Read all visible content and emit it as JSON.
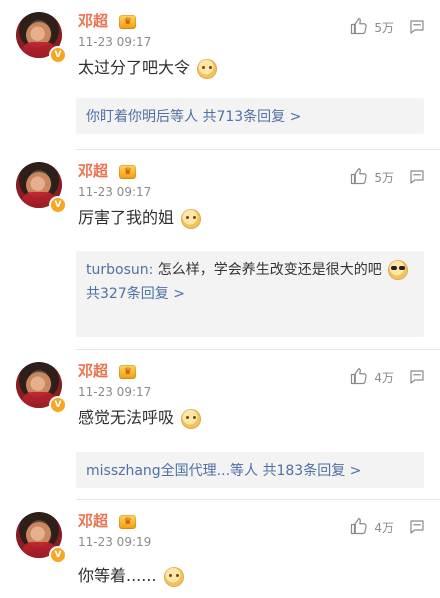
{
  "comments": [
    {
      "user": "邓超",
      "time": "11-23 09:17",
      "likes": "5万",
      "text": "太过分了吧大令",
      "reply_summary": {
        "users": "你盯着你明后",
        "suffix": "等人",
        "count": "共713条回复",
        "chevron": ">"
      }
    },
    {
      "user": "邓超",
      "time": "11-23 09:17",
      "likes": "5万",
      "text": "厉害了我的姐",
      "reply_preview": {
        "user": "turbosun:",
        "text": "怎么样，学会养生改变还是很大的吧",
        "count": "共327条回复",
        "chevron": ">"
      }
    },
    {
      "user": "邓超",
      "time": "11-23 09:17",
      "likes": "4万",
      "text": "感觉无法呼吸",
      "reply_summary": {
        "users": "misszhang全国代理...",
        "suffix": "等人",
        "count": "共183条回复",
        "chevron": ">"
      }
    },
    {
      "user": "邓超",
      "time": "11-23 09:19",
      "likes": "4万",
      "text": "你等着......"
    }
  ],
  "badges": {
    "vip_label": "V",
    "crown_label": "♛"
  },
  "icons": {
    "like": "thumbs-up-icon",
    "reply": "comment-icon",
    "emoji": "doge-emoji",
    "emoji_cool": "sunglasses-emoji"
  },
  "colors": {
    "name_orange": "#eb7350",
    "link_blue": "#4e70a6",
    "meta_gray": "#8a8a8a",
    "reply_bg": "#f3f3f3"
  }
}
